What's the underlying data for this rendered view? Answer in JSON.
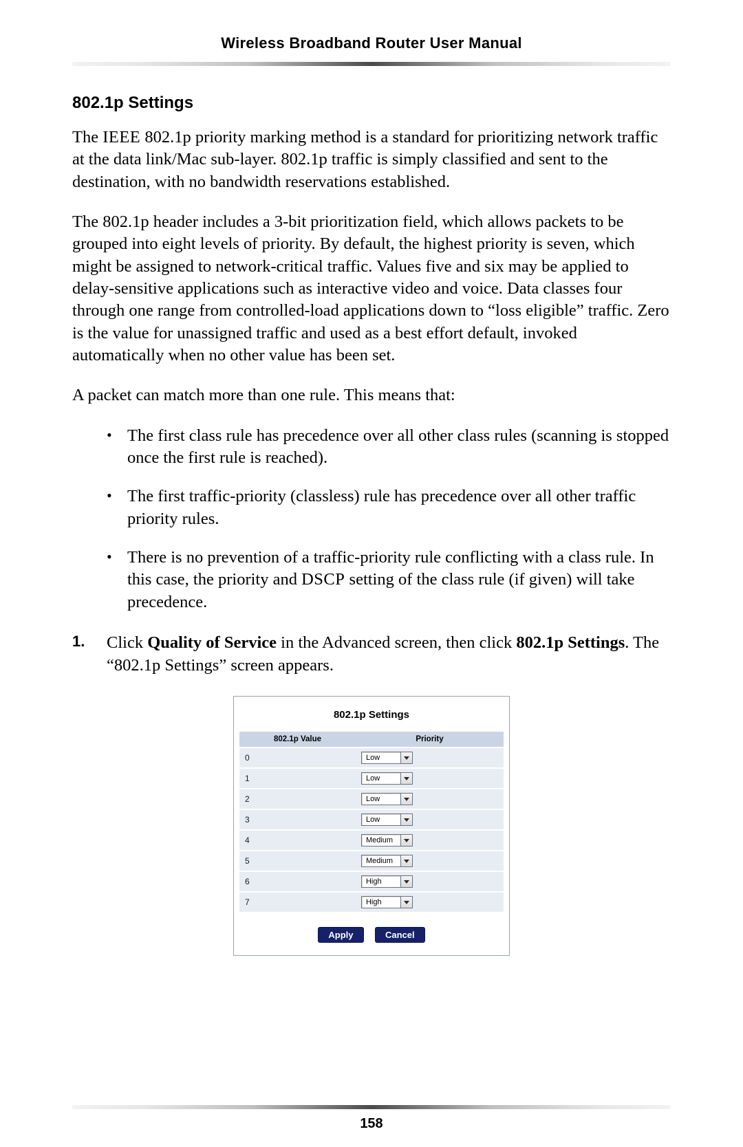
{
  "header": {
    "running_title": "Wireless Broadband Router User Manual"
  },
  "section": {
    "heading": "802.1p Settings",
    "p1_a": "The ",
    "p1_ieee": "IEEE",
    "p1_b": " 802.1p priority marking method is a standard for prioritizing network traffic at the data link/Mac sub-layer. 802.1p traffic is simply classified and sent to the destination, with no bandwidth reservations established.",
    "p2": "The 802.1p header includes a 3-bit prioritization field, which allows packets to be grouped into eight levels of priority. By default, the highest priority is seven, which might be assigned to network-critical traffic. Values five and six may be applied to delay-sensitive applications such as interactive video and voice. Data classes four through one range from controlled-load applications down to “loss eligible” traffic. Zero is the value for unassigned traffic and used as a best effort default, invoked automatically when no other value has been set.",
    "p3": "A packet can match more than one rule. This means that:",
    "bullets": [
      "The first class rule has precedence over all other class rules (scanning is stopped once the first rule is reached).",
      "The first traffic-priority (classless) rule has precedence over all other traffic priority rules.",
      {
        "pre": "There is no prevention of a traffic-priority rule conflicting with a class rule. In this case, the priority and ",
        "dscp": "DSCP",
        "post": " setting of the class rule (if given) will take precedence."
      }
    ],
    "step1_num": "1.",
    "step1_a": "Click ",
    "step1_qos": "Quality of Service",
    "step1_b": " in the Advanced screen, then click ",
    "step1_link": "802.1p Settings",
    "step1_c": ". The “802.1p Settings” screen appears."
  },
  "panel": {
    "title": "802.1p Settings",
    "col_value": "802.1p Value",
    "col_priority": "Priority",
    "rows": [
      {
        "value": "0",
        "priority": "Low"
      },
      {
        "value": "1",
        "priority": "Low"
      },
      {
        "value": "2",
        "priority": "Low"
      },
      {
        "value": "3",
        "priority": "Low"
      },
      {
        "value": "4",
        "priority": "Medium"
      },
      {
        "value": "5",
        "priority": "Medium"
      },
      {
        "value": "6",
        "priority": "High"
      },
      {
        "value": "7",
        "priority": "High"
      }
    ],
    "apply_label": "Apply",
    "cancel_label": "Cancel"
  },
  "footer": {
    "page_number": "158"
  }
}
